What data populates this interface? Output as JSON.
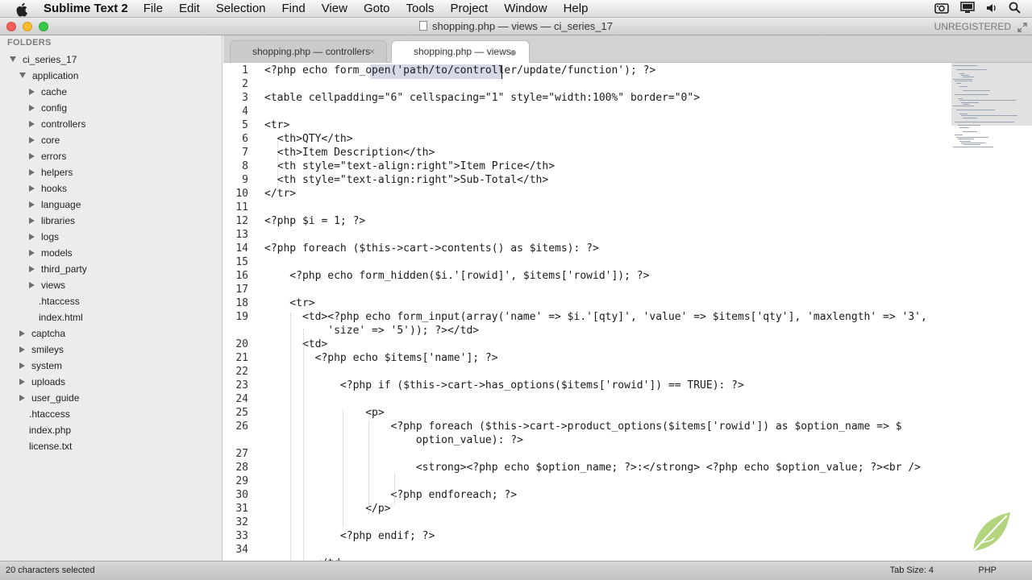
{
  "menubar": {
    "app_name": "Sublime Text 2",
    "menus": [
      "File",
      "Edit",
      "Selection",
      "Find",
      "View",
      "Goto",
      "Tools",
      "Project",
      "Window",
      "Help"
    ]
  },
  "window": {
    "title": "shopping.php — views — ci_series_17",
    "registration": "UNREGISTERED"
  },
  "sidebar": {
    "header": "FOLDERS",
    "items": [
      {
        "label": "ci_series_17",
        "state": "open"
      },
      {
        "label": "application",
        "state": "open"
      },
      {
        "label": "cache",
        "state": "closed"
      },
      {
        "label": "config",
        "state": "closed"
      },
      {
        "label": "controllers",
        "state": "closed"
      },
      {
        "label": "core",
        "state": "closed"
      },
      {
        "label": "errors",
        "state": "closed"
      },
      {
        "label": "helpers",
        "state": "closed"
      },
      {
        "label": "hooks",
        "state": "closed"
      },
      {
        "label": "language",
        "state": "closed"
      },
      {
        "label": "libraries",
        "state": "closed"
      },
      {
        "label": "logs",
        "state": "closed"
      },
      {
        "label": "models",
        "state": "closed"
      },
      {
        "label": "third_party",
        "state": "closed"
      },
      {
        "label": "views",
        "state": "closed"
      },
      {
        "label": ".htaccess",
        "state": "file"
      },
      {
        "label": "index.html",
        "state": "file"
      },
      {
        "label": "captcha",
        "state": "closed"
      },
      {
        "label": "smileys",
        "state": "closed"
      },
      {
        "label": "system",
        "state": "closed"
      },
      {
        "label": "uploads",
        "state": "closed"
      },
      {
        "label": "user_guide",
        "state": "closed"
      },
      {
        "label": ".htaccess",
        "state": "file"
      },
      {
        "label": "index.php",
        "state": "file"
      },
      {
        "label": "license.txt",
        "state": "file"
      }
    ]
  },
  "tabs": [
    {
      "label": "shopping.php — controllers",
      "close": "×",
      "active": false
    },
    {
      "label": "shopping.php — views",
      "active": true,
      "modified": true
    }
  ],
  "editor": {
    "lines": [
      {
        "n": "1",
        "text": "<?php echo form_open('path/to/controller/update/function'); ?>"
      },
      {
        "n": "2",
        "text": ""
      },
      {
        "n": "3",
        "text": "<table cellpadding=\"6\" cellspacing=\"1\" style=\"width:100%\" border=\"0\">"
      },
      {
        "n": "4",
        "text": ""
      },
      {
        "n": "5",
        "text": "<tr>"
      },
      {
        "n": "6",
        "text": "  <th>QTY</th>"
      },
      {
        "n": "7",
        "text": "  <th>Item Description</th>"
      },
      {
        "n": "8",
        "text": "  <th style=\"text-align:right\">Item Price</th>"
      },
      {
        "n": "9",
        "text": "  <th style=\"text-align:right\">Sub-Total</th>"
      },
      {
        "n": "10",
        "text": "</tr>"
      },
      {
        "n": "11",
        "text": ""
      },
      {
        "n": "12",
        "text": "<?php $i = 1; ?>"
      },
      {
        "n": "13",
        "text": ""
      },
      {
        "n": "14",
        "text": "<?php foreach ($this->cart->contents() as $items): ?>"
      },
      {
        "n": "15",
        "text": ""
      },
      {
        "n": "16",
        "text": "    <?php echo form_hidden($i.'[rowid]', $items['rowid']); ?>"
      },
      {
        "n": "17",
        "text": ""
      },
      {
        "n": "18",
        "text": "    <tr>"
      },
      {
        "n": "19",
        "text": "      <td><?php echo form_input(array('name' => $i.'[qty]', 'value' => $items['qty'], 'maxlength' => '3',"
      },
      {
        "n": "",
        "text": "          'size' => '5')); ?></td>"
      },
      {
        "n": "20",
        "text": "      <td>"
      },
      {
        "n": "21",
        "text": "        <?php echo $items['name']; ?>"
      },
      {
        "n": "22",
        "text": ""
      },
      {
        "n": "23",
        "text": "            <?php if ($this->cart->has_options($items['rowid']) == TRUE): ?>"
      },
      {
        "n": "24",
        "text": ""
      },
      {
        "n": "25",
        "text": "                <p>"
      },
      {
        "n": "26",
        "text": "                    <?php foreach ($this->cart->product_options($items['rowid']) as $option_name => $"
      },
      {
        "n": "",
        "text": "                        option_value): ?>"
      },
      {
        "n": "27",
        "text": ""
      },
      {
        "n": "28",
        "text": "                        <strong><?php echo $option_name; ?>:</strong> <?php echo $option_value; ?><br />"
      },
      {
        "n": "29",
        "text": ""
      },
      {
        "n": "30",
        "text": "                    <?php endforeach; ?>"
      },
      {
        "n": "31",
        "text": "                </p>"
      },
      {
        "n": "32",
        "text": ""
      },
      {
        "n": "33",
        "text": "            <?php endif; ?>"
      },
      {
        "n": "34",
        "text": ""
      },
      {
        "n": "",
        "text": "        </td>"
      }
    ]
  },
  "statusbar": {
    "selection": "20 characters selected",
    "tab_size": "Tab Size: 4",
    "syntax": "PHP"
  },
  "colors": {
    "selection": "#d5d9e6",
    "sidebar_bg": "#ececec",
    "close_light": "#f25f58",
    "min_light": "#fbbd2e",
    "zoom_light": "#39c84a"
  }
}
